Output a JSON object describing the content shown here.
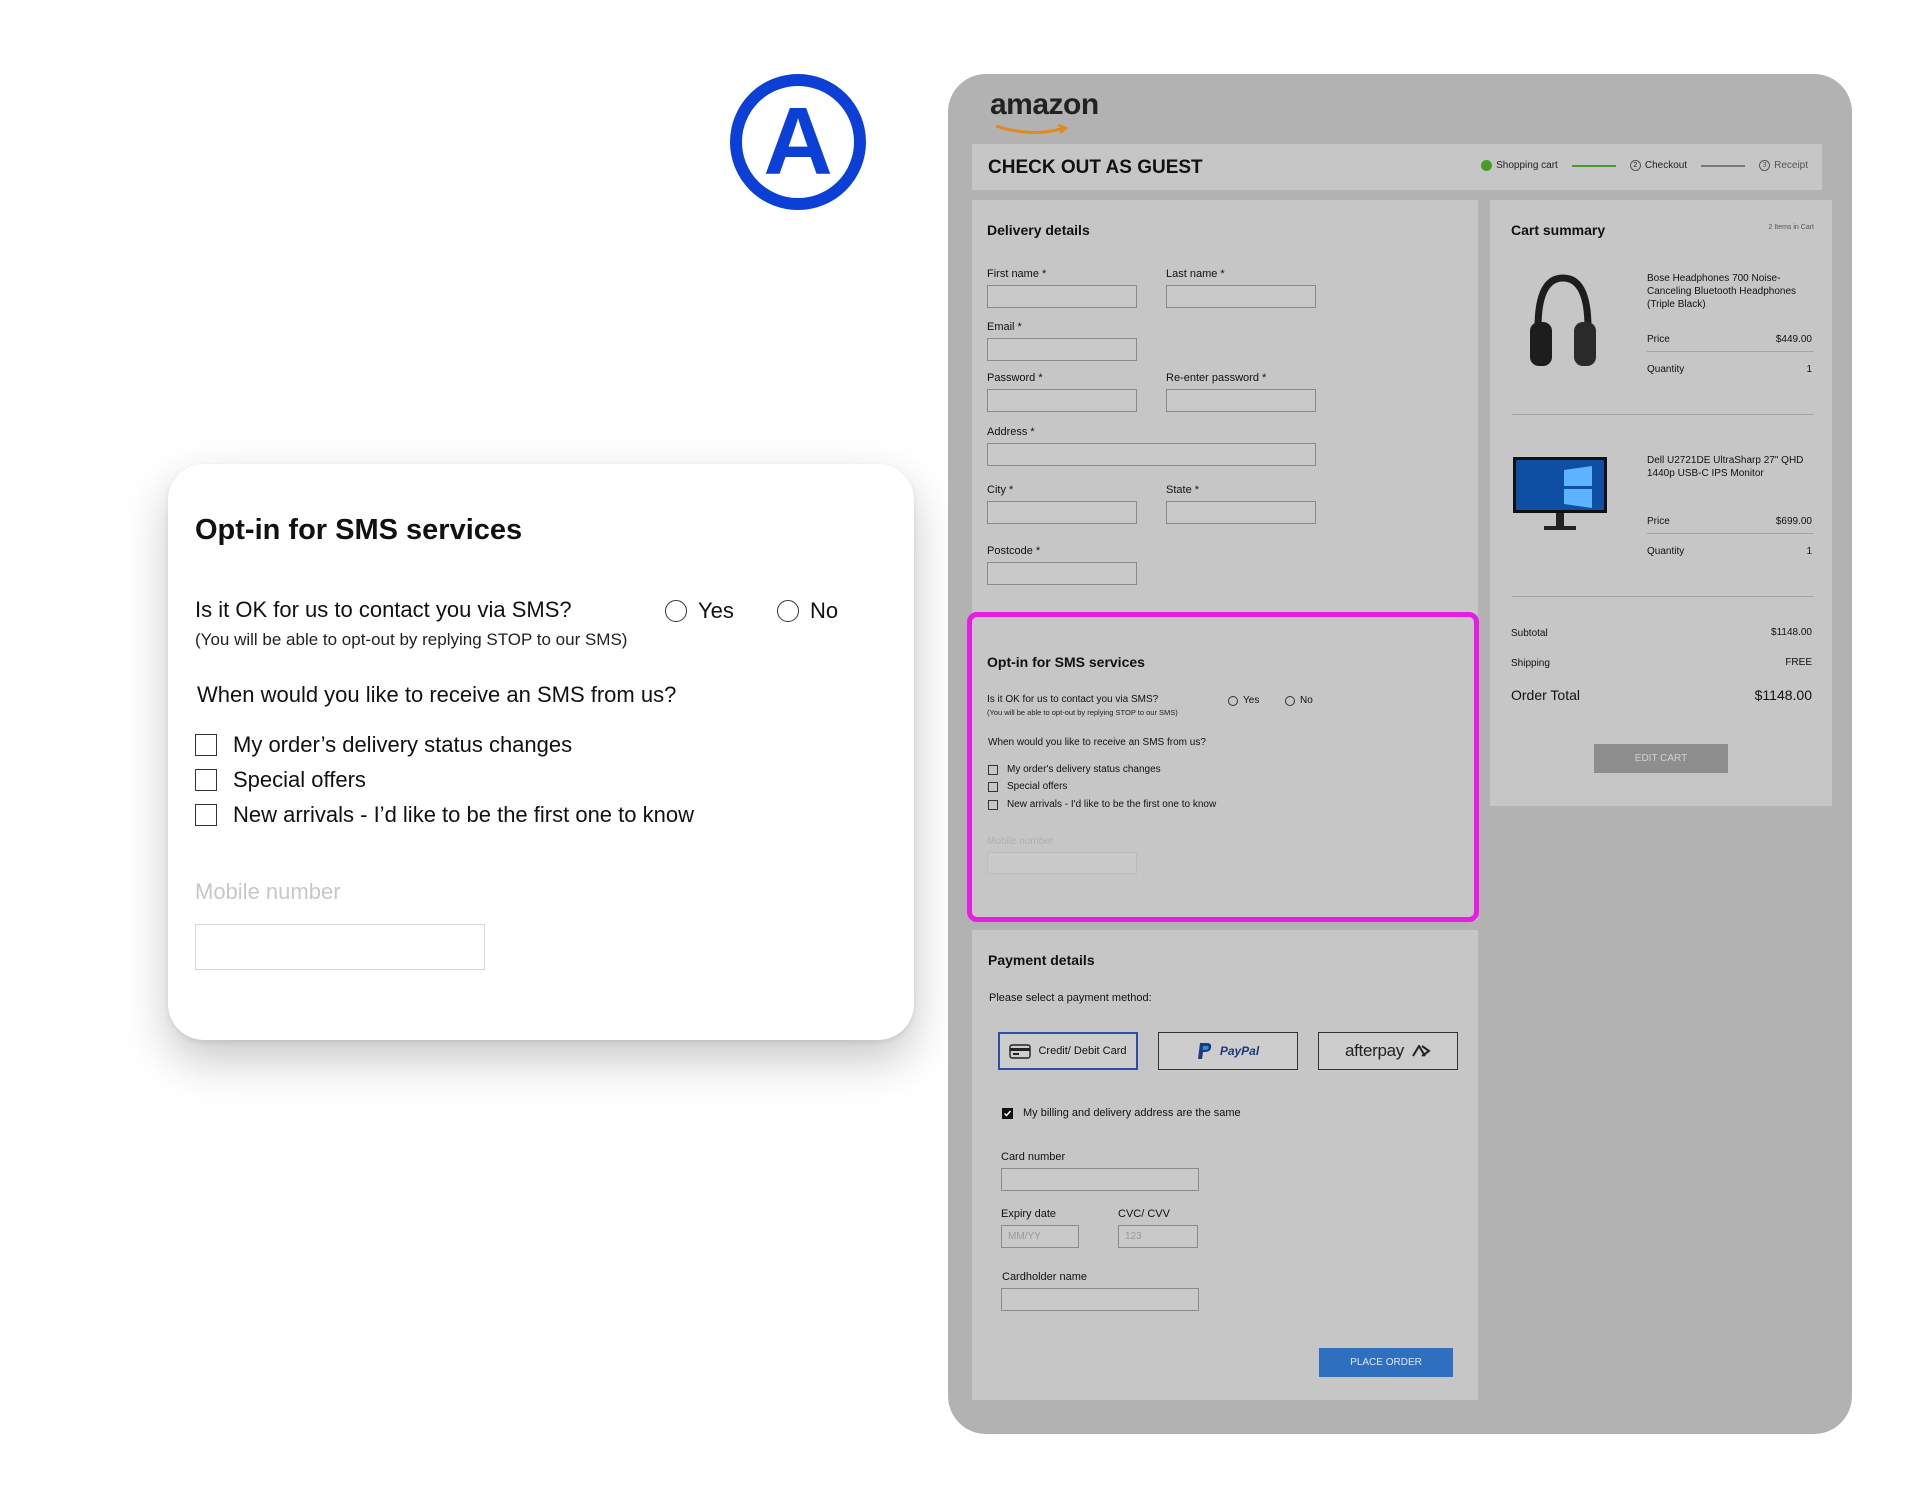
{
  "badge": {
    "letter": "A"
  },
  "zoom": {
    "title": "Opt-in for SMS services",
    "question": "Is it OK for us to contact you via SMS?",
    "question_sub": "(You will be able to opt-out by replying STOP to our SMS)",
    "yes": "Yes",
    "no": "No",
    "when": "When would you like to receive an SMS from us?",
    "options": [
      "My order’s delivery status changes",
      "Special offers",
      "New arrivals - I’d like to be the first one to know"
    ],
    "mobile_label": "Mobile number"
  },
  "page": {
    "logo": "amazon",
    "title": "CHECK OUT AS GUEST",
    "steps": [
      "Shopping cart",
      "Checkout",
      "Receipt"
    ],
    "step_numbers": [
      "2",
      "3"
    ],
    "colors": {
      "accent": "#2f6fc0",
      "highlight": "#e61de3",
      "step_done": "#4a9a2e"
    }
  },
  "delivery": {
    "title": "Delivery details",
    "first_name": "First name *",
    "last_name": "Last name *",
    "email": "Email *",
    "password": "Password *",
    "reenter": "Re-enter password *",
    "address": "Address *",
    "city": "City *",
    "state": "State *",
    "postcode": "Postcode *"
  },
  "sms": {
    "title": "Opt-in for SMS services",
    "question": "Is it OK for us to contact you via SMS?",
    "question_sub": "(You will be able to opt-out by replying STOP to our SMS)",
    "yes": "Yes",
    "no": "No",
    "when": "When would you like to receive an SMS from us?",
    "options": [
      "My order's delivery status changes",
      "Special offers",
      "New arrivals - I'd like to be the first one to know"
    ],
    "mobile_label": "Mobile number"
  },
  "payment": {
    "title": "Payment details",
    "select": "Please select a payment method:",
    "methods": [
      "Credit/ Debit Card",
      "PayPal",
      "afterpay"
    ],
    "billing_same": "My billing and delivery address are the same",
    "card_number": "Card number",
    "expiry": "Expiry date",
    "expiry_placeholder": "MM/YY",
    "cvc": "CVC/ CVV",
    "cvc_placeholder": "123",
    "cardholder": "Cardholder name",
    "place_order": "PLACE ORDER"
  },
  "cart": {
    "title": "Cart summary",
    "count": "2 Items in Cart",
    "items": [
      {
        "name": "Bose Headphones 700 Noise-Canceling Bluetooth Headphones (Triple Black)",
        "price_label": "Price",
        "price": "$449.00",
        "qty_label": "Quantity",
        "qty": "1"
      },
      {
        "name": "Dell U2721DE UltraSharp 27\" QHD 1440p USB-C IPS Monitor",
        "price_label": "Price",
        "price": "$699.00",
        "qty_label": "Quantity",
        "qty": "1"
      }
    ],
    "subtotal_label": "Subtotal",
    "subtotal": "$1148.00",
    "shipping_label": "Shipping",
    "shipping": "FREE",
    "total_label": "Order Total",
    "total": "$1148.00",
    "edit": "EDIT CART"
  }
}
